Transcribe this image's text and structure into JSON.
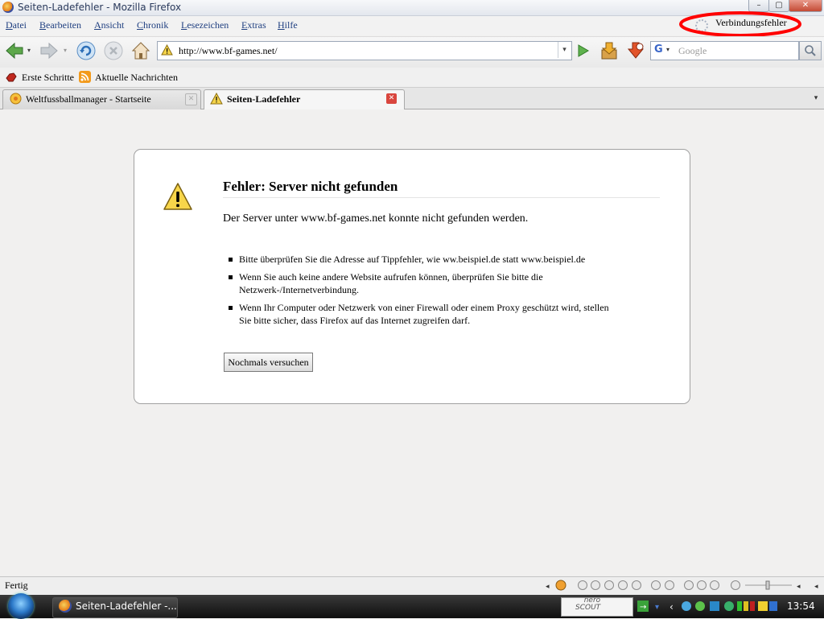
{
  "window": {
    "title": "Seiten-Ladefehler - Mozilla Firefox",
    "controls": {
      "minimize": "–",
      "maximize": "▢",
      "close": "✕"
    }
  },
  "menu": {
    "items": [
      "Datei",
      "Bearbeiten",
      "Ansicht",
      "Chronik",
      "Lesezeichen",
      "Extras",
      "Hilfe"
    ],
    "connection_status": "Verbindungsfehler"
  },
  "navbar": {
    "url": "http://www.bf-games.net/",
    "url_dropdown": "▾",
    "search_placeholder": "Google",
    "search_engine_letter": "G",
    "icons": [
      "back-icon",
      "forward-icon",
      "reload-icon",
      "stop-icon",
      "home-icon",
      "warning-icon",
      "go-icon",
      "download-icon",
      "addon-icon",
      "search-icon"
    ]
  },
  "bookmarks": {
    "items": [
      {
        "label": "Erste Schritte",
        "icon": "bookmark-icon"
      },
      {
        "label": "Aktuelle Nachrichten",
        "icon": "rss-icon"
      }
    ]
  },
  "tabs": {
    "items": [
      {
        "label": "Weltfussballmanager - Startseite",
        "active": false
      },
      {
        "label": "Seiten-Ladefehler",
        "active": true
      }
    ],
    "overflow": "▾"
  },
  "error_page": {
    "title": "Fehler: Server nicht gefunden",
    "description": "Der Server unter www.bf-games.net konnte nicht gefunden werden.",
    "bullets": [
      "Bitte überprüfen Sie die Adresse auf Tippfehler, wie ww.beispiel.de statt www.beispiel.de",
      "Wenn Sie auch keine andere Website aufrufen können, überprüfen Sie bitte die Netzwerk-/Internetverbindung.",
      "Wenn Ihr Computer oder Netzwerk von einer Firewall oder einem Proxy geschützt wird, stellen Sie bitte sicher, dass Firefox auf das Internet zugreifen darf."
    ],
    "retry_button": "Nochmals versuchen"
  },
  "statusbar": {
    "status": "Fertig"
  },
  "taskbar": {
    "task_label": "Seiten-Ladefehler -...",
    "nero_line1": "nero",
    "nero_line2": "SCOUT",
    "clock": "13:54"
  },
  "colors": {
    "annotation_red": "#ff0000",
    "link_blue": "#1f3f80",
    "tab_close_red": "#d9463e",
    "warning_yellow": "#f5d44a"
  }
}
